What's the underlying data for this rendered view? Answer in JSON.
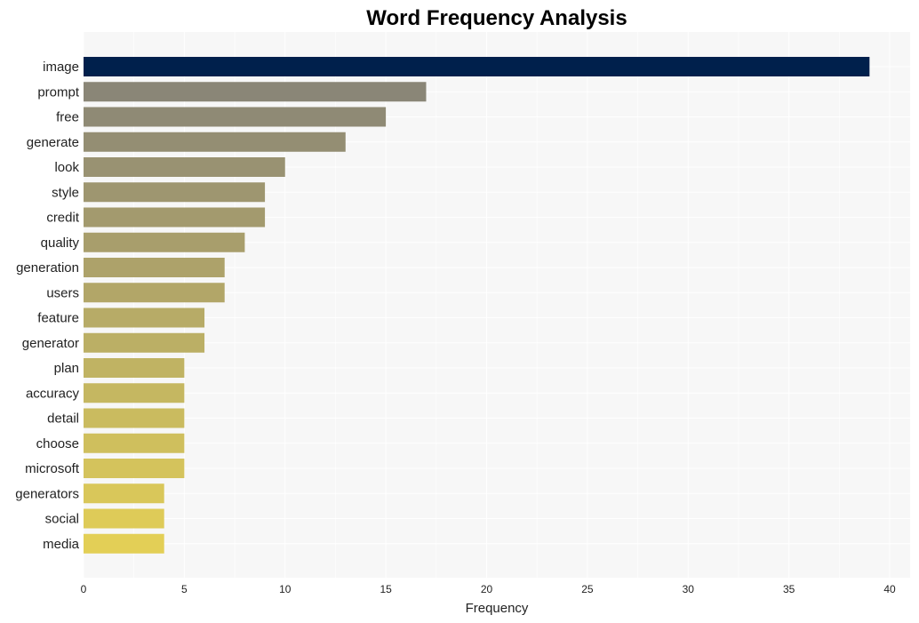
{
  "chart_data": {
    "type": "bar",
    "orientation": "horizontal",
    "title": "Word Frequency Analysis",
    "xlabel": "Frequency",
    "ylabel": "",
    "xlim": [
      0,
      41
    ],
    "xticks": [
      0,
      5,
      10,
      15,
      20,
      25,
      30,
      35,
      40
    ],
    "grid": true,
    "legend": "none",
    "categories": [
      "image",
      "prompt",
      "free",
      "generate",
      "look",
      "style",
      "credit",
      "quality",
      "generation",
      "users",
      "feature",
      "generator",
      "plan",
      "accuracy",
      "detail",
      "choose",
      "microsoft",
      "generators",
      "social",
      "media"
    ],
    "values": [
      39,
      17,
      15,
      13,
      10,
      9,
      9,
      8,
      7,
      7,
      6,
      6,
      5,
      5,
      5,
      5,
      5,
      4,
      4,
      4
    ],
    "colors": {
      "top": "#00204c",
      "gradient_start": "#8a8677",
      "gradient_end": "#e3cf56",
      "plot_background": "#f7f7f7",
      "grid": "#ffffff"
    }
  }
}
